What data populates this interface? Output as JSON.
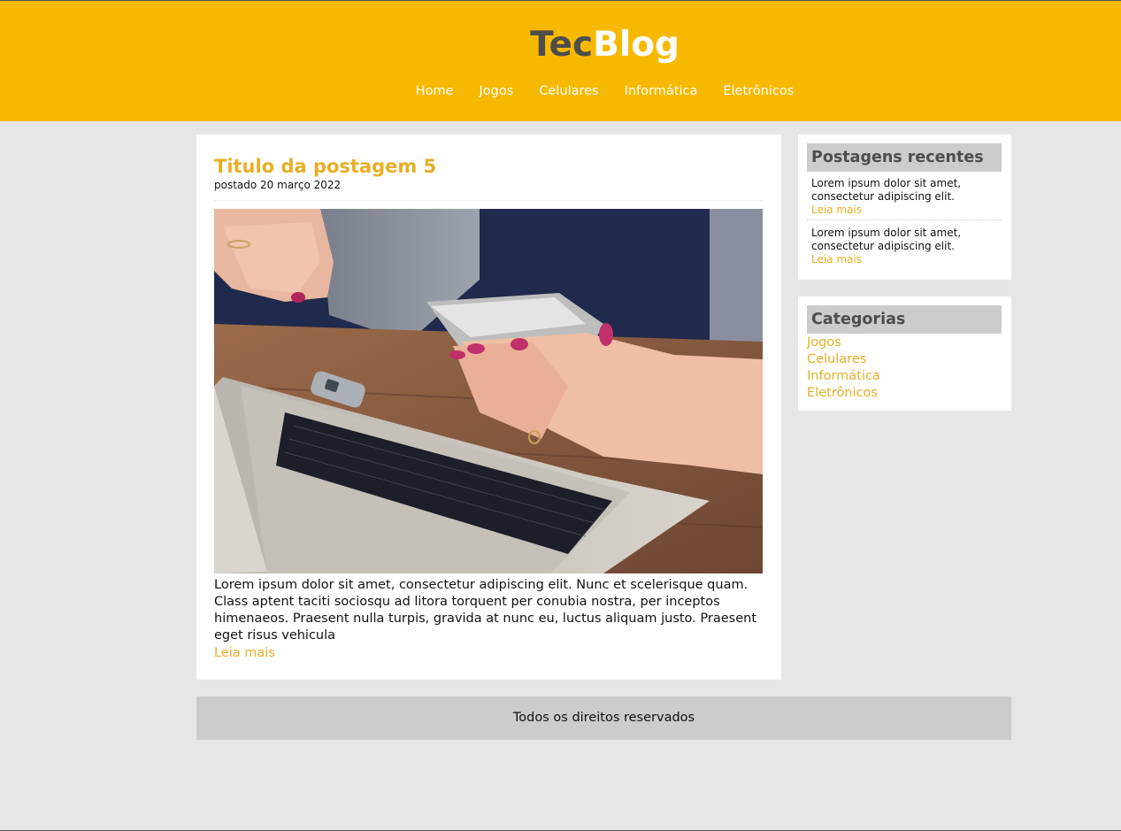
{
  "header": {
    "logo_part1": "Tec",
    "logo_part2": "Blog",
    "brand_color": "#f7b900",
    "nav": [
      "Home",
      "Jogos",
      "Celulares",
      "Informática",
      "Eletrônicos"
    ]
  },
  "post": {
    "title": "Titulo da postagem 5",
    "date": "postado 20 março 2022",
    "image_icon": "photo-laptop-phone",
    "text": "Lorem ipsum dolor sit amet, consectetur adipiscing elit. Nunc et scelerisque quam. Class aptent taciti sociosqu ad litora torquent per conubia nostra, per inceptos himenaeos. Praesent nulla turpis, gravida at nunc eu, luctus aliquam justo. Praesent eget risus vehicula",
    "more": "Leia mais"
  },
  "sidebar": {
    "recent": {
      "title": "Postagens recentes",
      "items": [
        {
          "text": "Lorem ipsum dolor sit amet, consectetur adipiscing elit.",
          "more": "Leia mais"
        },
        {
          "text": "Lorem ipsum dolor sit amet, consectetur adipiscing elit.",
          "more": "Leia mais"
        }
      ]
    },
    "categories": {
      "title": "Categorias",
      "items": [
        "Jogos",
        "Celulares",
        "Informática",
        "Eletrônicos"
      ]
    }
  },
  "footer": {
    "text": "Todos os direitos reservados"
  },
  "colors": {
    "accent": "#e7ae26",
    "background": "#e6e6e6",
    "widget_title_bg": "#cccccc"
  }
}
